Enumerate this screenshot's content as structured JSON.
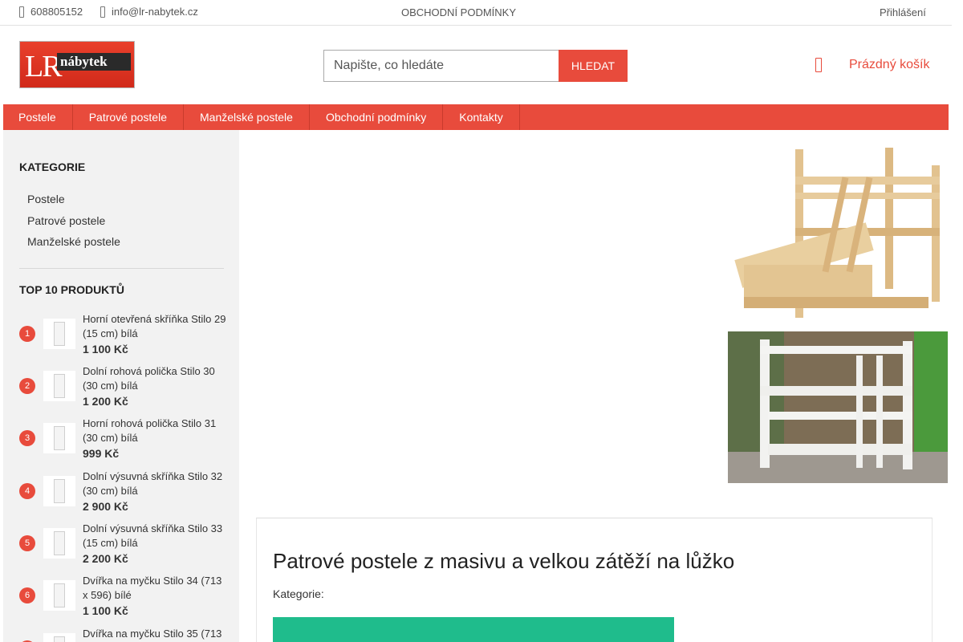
{
  "topbar": {
    "phone": "608805152",
    "email": "info@lr-nabytek.cz",
    "terms_link": "OBCHODNÍ PODMÍNKY",
    "login": "Přihlášení"
  },
  "logo": {
    "text_lr": "LR",
    "text_nabytek": "nábytek"
  },
  "search": {
    "placeholder": "Napište, co hledáte",
    "button": "HLEDAT"
  },
  "cart": {
    "label": "Prázdný košík"
  },
  "nav": [
    {
      "label": "Postele"
    },
    {
      "label": "Patrové postele"
    },
    {
      "label": "Manželské postele"
    },
    {
      "label": "Obchodní podmínky"
    },
    {
      "label": "Kontakty"
    }
  ],
  "sidebar": {
    "categories_title": "KATEGORIE",
    "categories": [
      {
        "label": "Postele"
      },
      {
        "label": "Patrové postele"
      },
      {
        "label": "Manželské postele"
      }
    ],
    "top_title": "TOP 10 PRODUKTŮ",
    "top_products": [
      {
        "rank": "1",
        "name": "Horní otevřená skříňka Stilo 29 (15 cm) bílá",
        "price": "1 100 Kč"
      },
      {
        "rank": "2",
        "name": "Dolní rohová polička Stilo 30 (30 cm) bílá",
        "price": "1 200 Kč"
      },
      {
        "rank": "3",
        "name": "Horní rohová polička Stilo 31 (30 cm) bílá",
        "price": "999 Kč"
      },
      {
        "rank": "4",
        "name": "Dolní výsuvná skříňka Stilo 32 (30 cm) bílá",
        "price": "2 900 Kč"
      },
      {
        "rank": "5",
        "name": "Dolní výsuvná skříňka Stilo 33 (15 cm) bílá",
        "price": "2 200 Kč"
      },
      {
        "rank": "6",
        "name": "Dvířka na myčku Stilo 34 (713 x 596) bílé",
        "price": "1 100 Kč"
      },
      {
        "rank": "7",
        "name": "Dvířka na myčku Stilo 35 (713",
        "price": ""
      }
    ]
  },
  "main": {
    "heading": "Patrové postele z masivu a velkou zátěží na lůžko",
    "category_label": "Kategorie:"
  },
  "colors": {
    "accent": "#e84b3c",
    "green": "#1fbc8c",
    "sidebar_bg": "#f2f2f2"
  }
}
